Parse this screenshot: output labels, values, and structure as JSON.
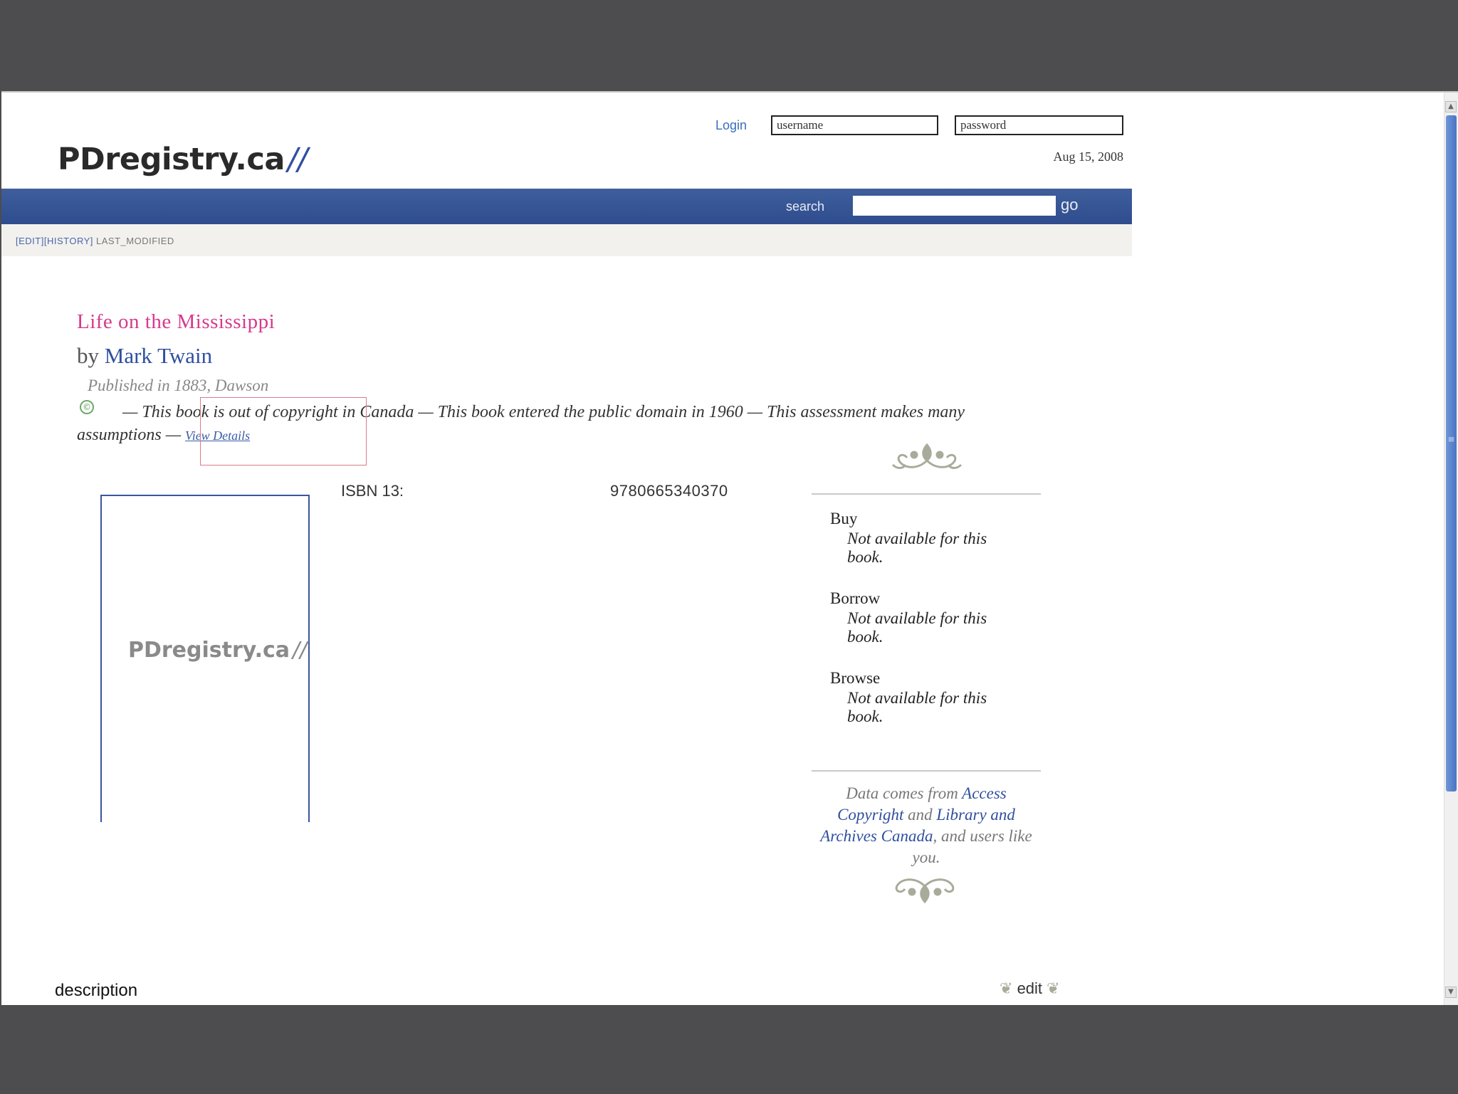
{
  "header": {
    "logo_text": "PDregistry.ca",
    "logo_slash": "//",
    "login_label": "Login",
    "username_value": "username",
    "password_value": "password",
    "date": "Aug 15, 2008"
  },
  "nav": {
    "search_label": "search",
    "search_value": "",
    "go_label": "go"
  },
  "subbar": {
    "edit_link": "[EDIT]",
    "history_link": "[HISTORY]",
    "last_modified": "LAST_MODIFIED"
  },
  "book": {
    "title": "Life on the Mississippi",
    "by_prefix": "by",
    "author": "Mark Twain",
    "published": "Published in 1883, Dawson",
    "status_text": "— This book is out of copyright in Canada — This book entered the public domain in 1960 — This assessment makes many assumptions —",
    "view_details": "View Details",
    "isbn_label": "ISBN 13:",
    "isbn_value": "9780665340370"
  },
  "cover": {
    "logo_text": "PDregistry.ca",
    "logo_slash": "//"
  },
  "sidebar": {
    "buy_heading": "Buy",
    "buy_text": "Not available for this book.",
    "borrow_heading": "Borrow",
    "borrow_text": "Not available for this book.",
    "browse_heading": "Browse",
    "browse_text": "Not available for this book.",
    "source_prefix": "Data comes from",
    "source_link1": "Access Copyright",
    "source_and": "and",
    "source_link2": "Library and Archives Canada",
    "source_suffix": ", and users like you."
  },
  "footer": {
    "description_label": "description",
    "edit_label": "edit"
  },
  "colors": {
    "title_pink": "#d63a8c",
    "author_blue": "#2f4f9f",
    "navbar_blue": "#34528f",
    "scroll_blue": "#5a82cc"
  },
  "icons": {
    "status": "public-domain-icon",
    "ornament": "fleuron-ornament-icon",
    "edit_leaf": "leaf-icon"
  }
}
